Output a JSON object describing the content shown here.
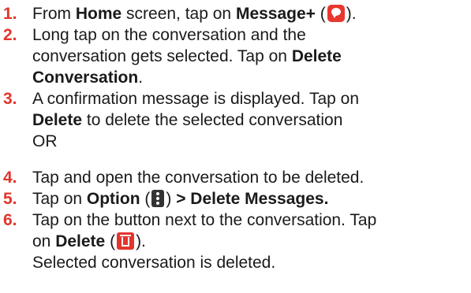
{
  "colors": {
    "number": "#e0362c",
    "text": "#1a1a1a"
  },
  "icons": [
    "message-plus-icon",
    "option-menu-icon",
    "trash-icon"
  ],
  "steps": [
    {
      "number": "1.",
      "t1": "From ",
      "b1": "Home",
      "t2": " screen, tap on ",
      "b2": "Message+",
      "t3": " (",
      "t4": ")."
    },
    {
      "number": "2.",
      "l1": "Long tap on the conversation and the",
      "l2a": "conversation gets selected. Tap on ",
      "l2b": "Delete",
      "l3": "Conversation",
      "l3p": "."
    },
    {
      "number": "3.",
      "l1": "A confirmation message is displayed. Tap on",
      "l2b": "Delete",
      "l2a": " to delete the selected conversation",
      "l3": "OR"
    },
    {
      "number": "4.",
      "l1": "Tap and open the conversation to be deleted."
    },
    {
      "number": "5.",
      "t1": "Tap on ",
      "b1": "Option",
      "t2": " (",
      "t3": ") ",
      "b2": "> Delete Messages."
    },
    {
      "number": "6.",
      "l1": "Tap on the button next to the conversation. Tap",
      "l2a": "on ",
      "l2b": "Delete",
      "l2c": " (",
      "l2d": ").",
      "l3": "Selected conversation is deleted."
    }
  ]
}
